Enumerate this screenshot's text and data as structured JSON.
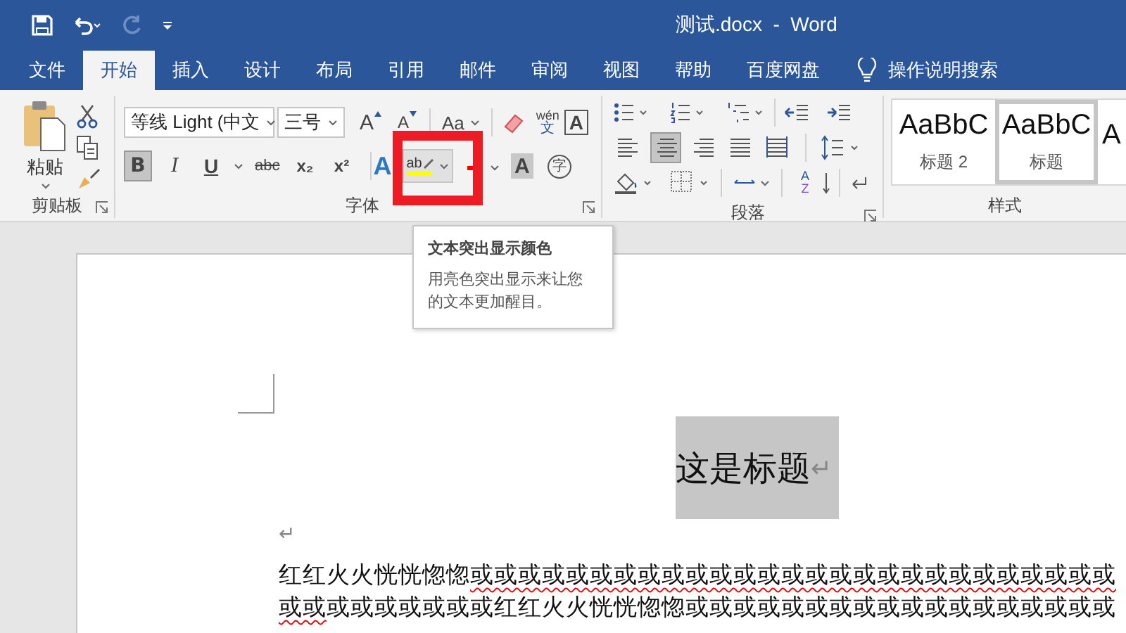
{
  "window": {
    "title": "测试.docx  -  Word"
  },
  "quick_access": [
    {
      "kind": "save",
      "disabled": false
    },
    {
      "kind": "undo",
      "disabled": false
    },
    {
      "kind": "redo",
      "disabled": true
    },
    {
      "kind": "customize",
      "disabled": false
    }
  ],
  "tabs": [
    {
      "label": "文件",
      "selected": false
    },
    {
      "label": "开始",
      "selected": true
    },
    {
      "label": "插入",
      "selected": false
    },
    {
      "label": "设计",
      "selected": false
    },
    {
      "label": "布局",
      "selected": false
    },
    {
      "label": "引用",
      "selected": false
    },
    {
      "label": "邮件",
      "selected": false
    },
    {
      "label": "审阅",
      "selected": false
    },
    {
      "label": "视图",
      "selected": false
    },
    {
      "label": "帮助",
      "selected": false
    },
    {
      "label": "百度网盘",
      "selected": false
    }
  ],
  "tell_me": {
    "label": "操作说明搜索"
  },
  "clipboard": {
    "paste": "粘贴",
    "label": "剪贴板"
  },
  "font": {
    "label": "字体",
    "font_name": "等线 Light (中文",
    "font_size": "三号",
    "grow": "A",
    "shrink": "A",
    "change_case": "Aa",
    "phonetic": "wén",
    "phonetic_char": "文",
    "border_char": "A",
    "formats": [
      {
        "kind": "bold",
        "text": "B",
        "selected": true
      },
      {
        "kind": "italic",
        "text": "I",
        "selected": false
      },
      {
        "kind": "underline",
        "text": "U",
        "selected": false
      },
      {
        "kind": "strike",
        "text": "abc",
        "selected": false
      },
      {
        "kind": "subscript",
        "text": "x₂",
        "selected": false
      },
      {
        "kind": "superscript",
        "text": "x²",
        "selected": false
      }
    ],
    "text_effects": "A",
    "highlight": {
      "text": "ab",
      "color": "#ffff00"
    },
    "font_color": {
      "color": "#ff0000"
    },
    "shading_char": "A",
    "enclose_char": "字"
  },
  "paragraph": {
    "label": "段落",
    "alignments": [
      {
        "kind": "left",
        "selected": false
      },
      {
        "kind": "center",
        "selected": true
      },
      {
        "kind": "right",
        "selected": false
      },
      {
        "kind": "justify",
        "selected": false
      },
      {
        "kind": "distributed",
        "selected": false
      }
    ],
    "sort_letters": [
      "A",
      "Z"
    ]
  },
  "styles": {
    "label": "样式",
    "items": [
      {
        "sample": "AaBbC",
        "name": "标题 2",
        "selected": false
      },
      {
        "sample": "AaBbC",
        "name": "标题",
        "selected": true
      },
      {
        "sample": "A",
        "selected": false
      }
    ]
  },
  "tooltip": {
    "title": "文本突出显示颜色",
    "body": "用亮色突出显示来让您的文本更加醒目。"
  },
  "document": {
    "heading": {
      "text": "这是标题",
      "highlighted": true,
      "mark": "↵"
    },
    "empty_mark": "↵",
    "lines": [
      [
        {
          "text": "红红火火恍恍惚惚",
          "misspelled": false
        },
        {
          "text": "或或或或或或或或或或或或或或或或或或或或或或或或或或或",
          "misspelled": true
        }
      ],
      [
        {
          "text": "或或",
          "misspelled": true
        },
        {
          "text": "或或或或或或或红红火火恍恍惚惚或或或或或或或或或或或或或或或或或或",
          "misspelled": false
        }
      ]
    ]
  }
}
